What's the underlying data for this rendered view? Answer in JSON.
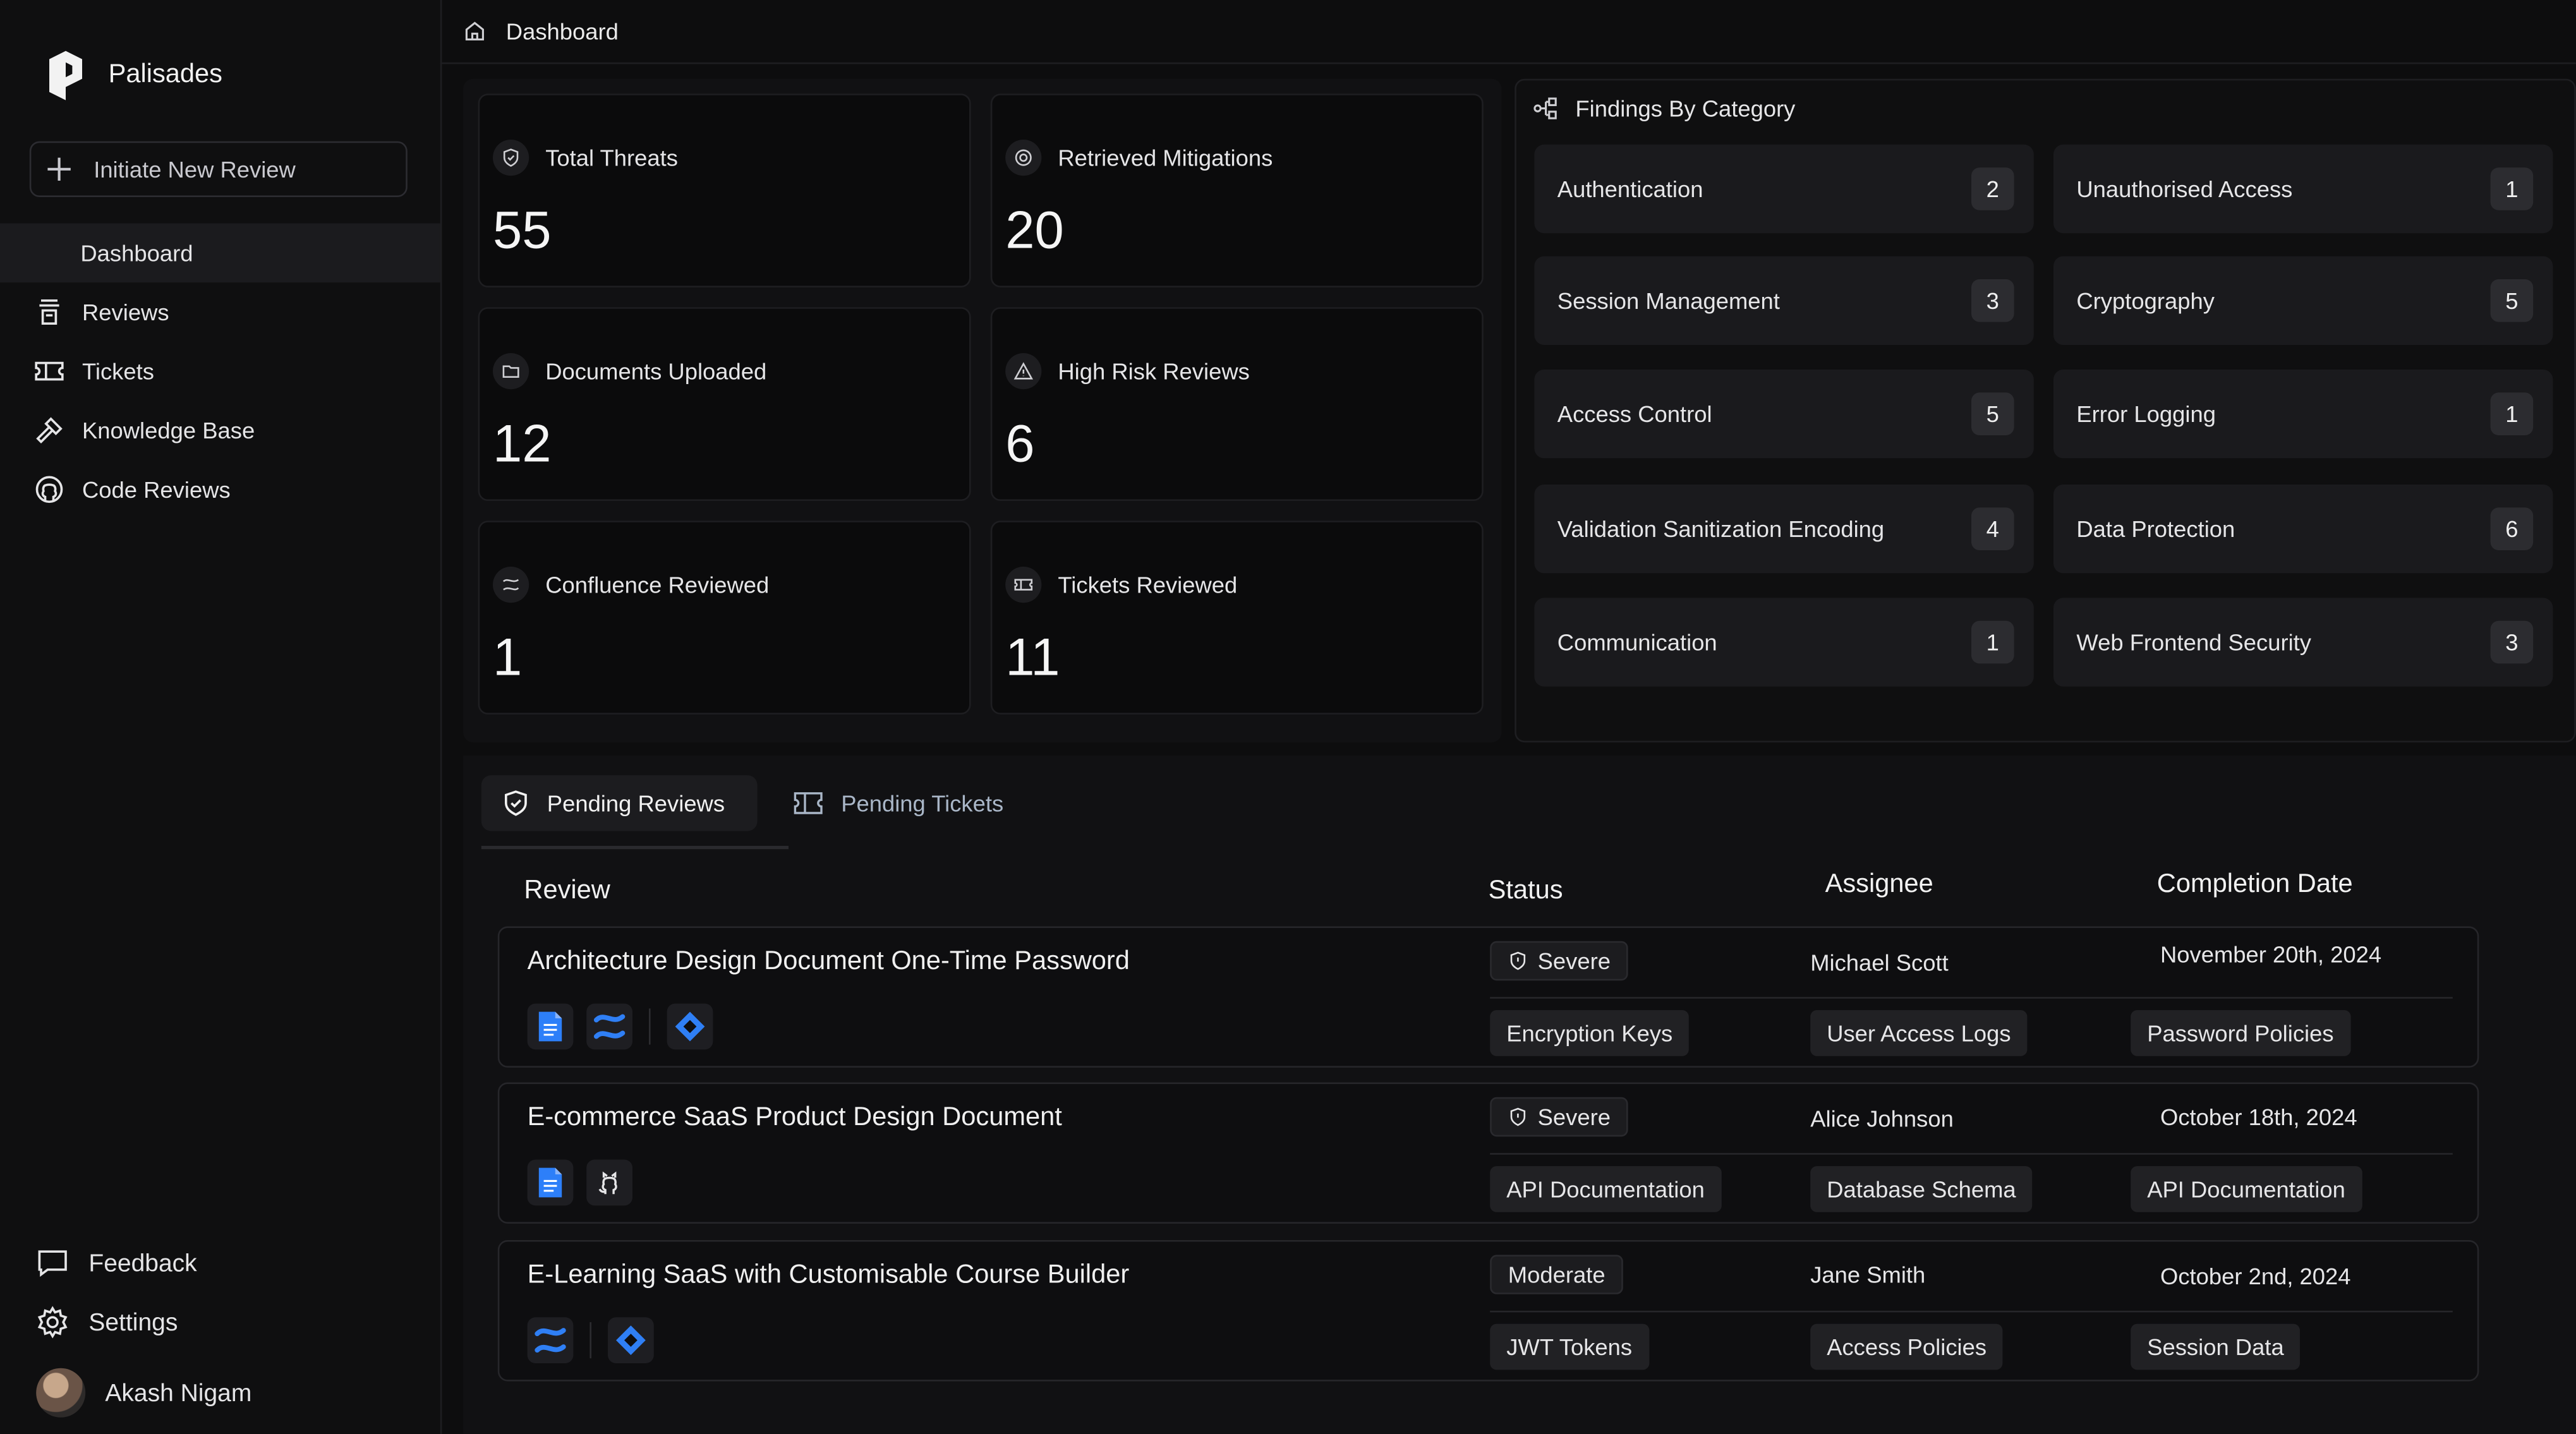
{
  "brand": {
    "name": "Palisades"
  },
  "sidebar": {
    "new_review": "Initiate New Review",
    "items": [
      {
        "label": "Dashboard",
        "icon": "dashboard"
      },
      {
        "label": "Reviews",
        "icon": "reviews-icon"
      },
      {
        "label": "Tickets",
        "icon": "ticket-icon"
      },
      {
        "label": "Knowledge Base",
        "icon": "hammer-icon"
      },
      {
        "label": "Code Reviews",
        "icon": "github-icon"
      }
    ],
    "feedback": "Feedback",
    "settings": "Settings",
    "user": "Akash Nigam"
  },
  "topbar": {
    "breadcrumb": "Dashboard"
  },
  "stats": [
    {
      "label": "Total Threats",
      "value": "55",
      "icon": "shield-icon"
    },
    {
      "label": "Retrieved Mitigations",
      "value": "20",
      "icon": "gear-icon"
    },
    {
      "label": "Documents Uploaded",
      "value": "12",
      "icon": "folder-icon"
    },
    {
      "label": "High Risk Reviews",
      "value": "6",
      "icon": "warning-icon"
    },
    {
      "label": "Confluence Reviewed",
      "value": "1",
      "icon": "confluence-icon"
    },
    {
      "label": "Tickets Reviewed",
      "value": "11",
      "icon": "ticket-icon"
    }
  ],
  "findings": {
    "title": "Findings By Category",
    "categories": [
      {
        "label": "Authentication",
        "count": "2"
      },
      {
        "label": "Unauthorised Access",
        "count": "1"
      },
      {
        "label": "Session Management",
        "count": "3"
      },
      {
        "label": "Cryptography",
        "count": "5"
      },
      {
        "label": "Access Control",
        "count": "5"
      },
      {
        "label": "Error Logging",
        "count": "1"
      },
      {
        "label": "Validation Sanitization Encoding",
        "count": "4"
      },
      {
        "label": "Data Protection",
        "count": "6"
      },
      {
        "label": "Communication",
        "count": "1"
      },
      {
        "label": "Web Frontend Security",
        "count": "3"
      }
    ]
  },
  "tabs": {
    "pending_reviews": "Pending Reviews",
    "pending_tickets": "Pending Tickets"
  },
  "table": {
    "headers": {
      "review": "Review",
      "status": "Status",
      "assignee": "Assignee",
      "completion": "Completion Date"
    },
    "rows": [
      {
        "title": "Architecture Design Document One-Time Password",
        "status": "Severe",
        "assignee": "Michael Scott",
        "date": "November 20th, 2024",
        "tags": [
          "Encryption Keys",
          "User Access Logs",
          "Password Policies"
        ]
      },
      {
        "title": "E-commerce SaaS Product Design Document",
        "status": "Severe",
        "assignee": "Alice Johnson",
        "date": "October 18th, 2024",
        "tags": [
          "API Documentation",
          "Database Schema",
          "API Documentation"
        ]
      },
      {
        "title": "E-Learning SaaS with Customisable Course Builder",
        "status": "Moderate",
        "assignee": "Jane Smith",
        "date": "October 2nd, 2024",
        "tags": [
          "JWT Tokens",
          "Access Policies",
          "Session Data"
        ]
      }
    ]
  },
  "colors": {
    "accent_blue": "#2f7ff5",
    "doc_blue": "#2d7ff9"
  }
}
